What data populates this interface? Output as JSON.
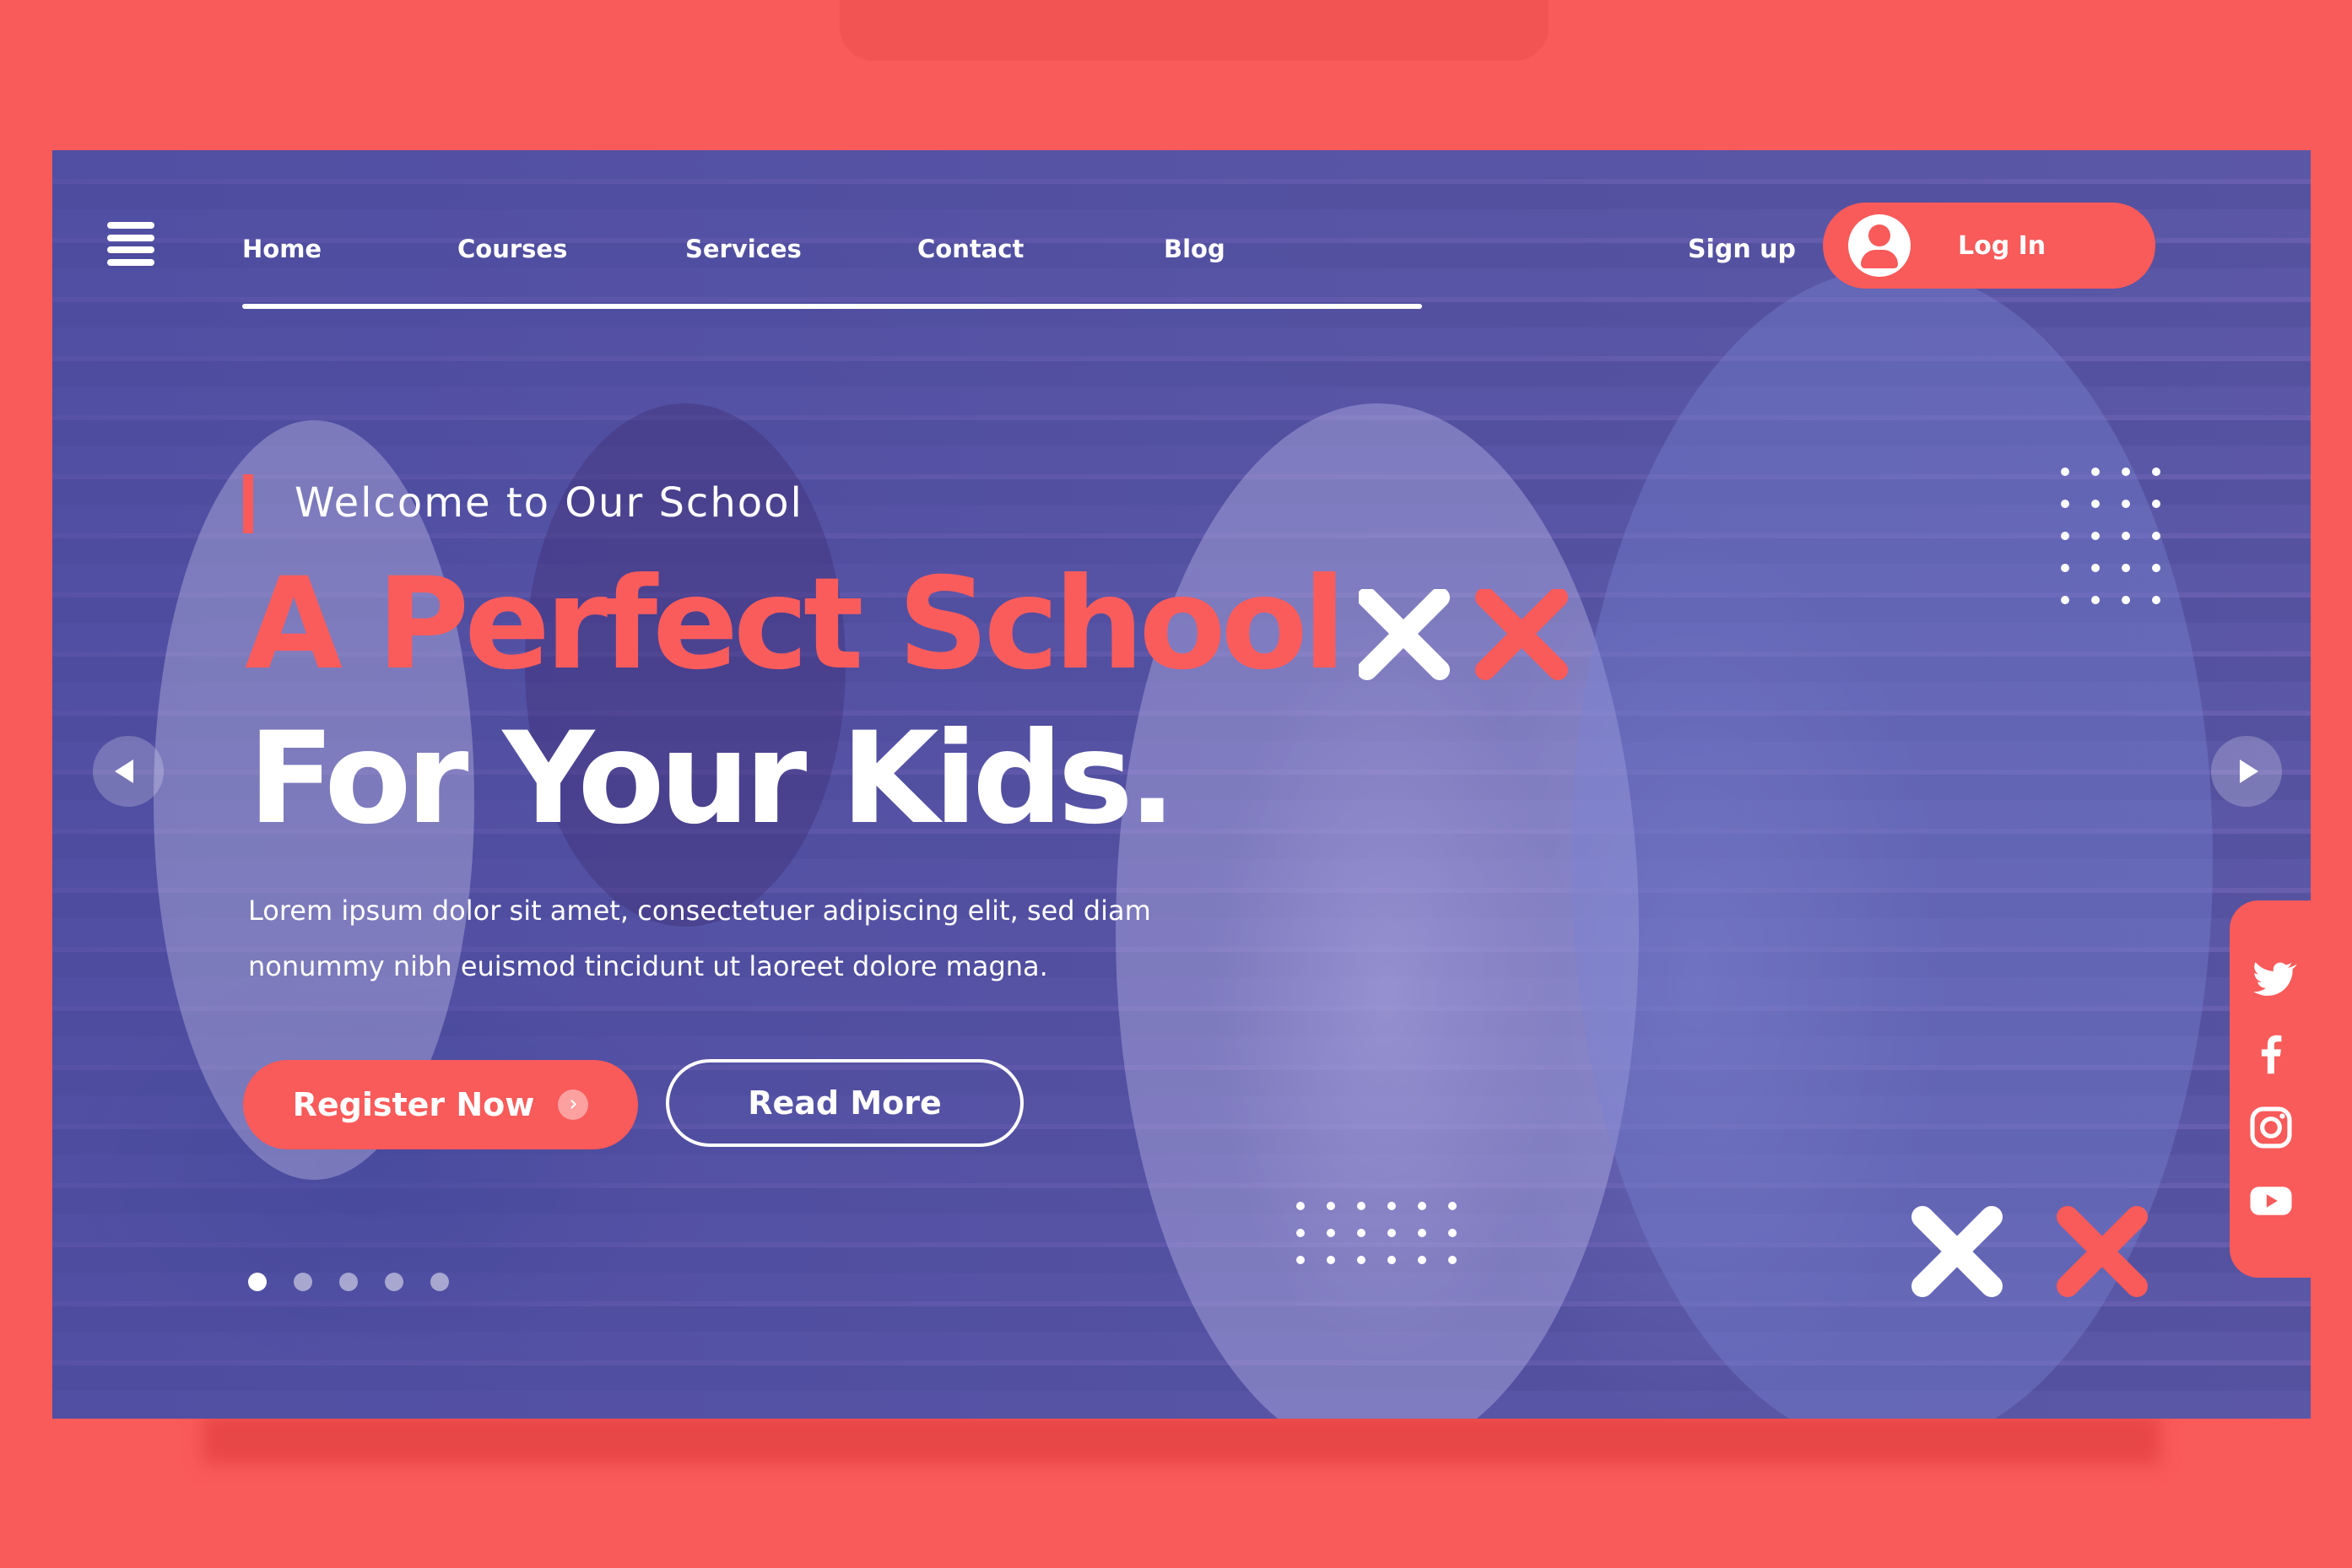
{
  "nav": {
    "home": "Home",
    "courses": "Courses",
    "services": "Services",
    "contact": "Contact",
    "blog": "Blog"
  },
  "auth": {
    "signup": "Sign up",
    "login": "Log In"
  },
  "hero": {
    "welcome": "Welcome to Our School",
    "title_line1": "A Perfect School",
    "title_line2": "For Your Kids.",
    "description_line1": "Lorem ipsum dolor sit amet, consectetuer adipiscing elit, sed diam",
    "description_line2": "nonummy nibh euismod tincidunt ut laoreet dolore magna."
  },
  "buttons": {
    "register": "Register Now",
    "read_more": "Read More"
  },
  "slider": {
    "total_slides": 5,
    "active_slide": 1
  },
  "social": [
    "twitter-icon",
    "facebook-icon",
    "instagram-icon",
    "youtube-icon"
  ],
  "colors": {
    "accent": "#f95a5a",
    "overlay": "#5a58a7",
    "text": "#ffffff"
  }
}
